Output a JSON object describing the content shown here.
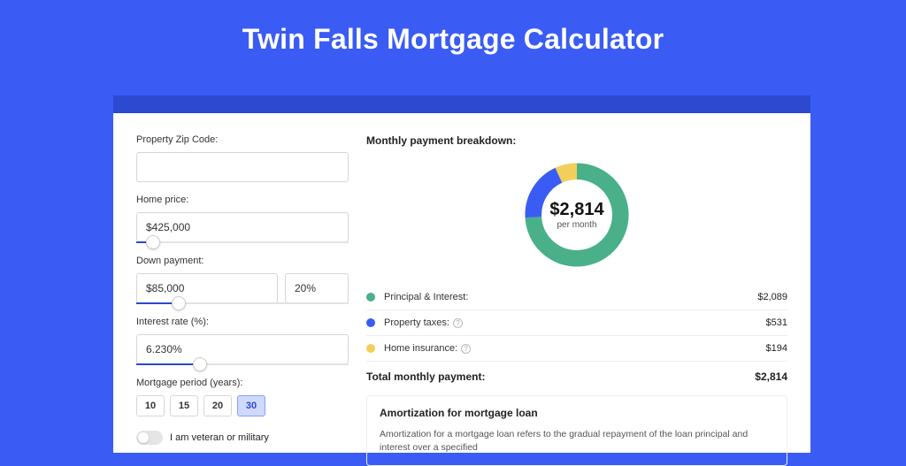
{
  "header": {
    "title": "Twin Falls Mortgage Calculator"
  },
  "form": {
    "zip": {
      "label": "Property Zip Code:",
      "value": ""
    },
    "home_price": {
      "label": "Home price:",
      "value": "$425,000",
      "slider_pct": 8
    },
    "down_payment": {
      "label": "Down payment:",
      "value": "$85,000",
      "pct": "20%",
      "slider_pct": 20
    },
    "interest": {
      "label": "Interest rate (%):",
      "value": "6.230%",
      "slider_pct": 30
    },
    "period": {
      "label": "Mortgage period (years):",
      "options": [
        "10",
        "15",
        "20",
        "30"
      ],
      "selected": "30"
    },
    "veteran": {
      "label": "I am veteran or military",
      "on": false
    }
  },
  "breakdown": {
    "title": "Monthly payment breakdown:",
    "total_value": "$2,814",
    "total_sub": "per month",
    "items": [
      {
        "label": "Principal & Interest:",
        "value": "$2,089",
        "color": "#49B08A",
        "has_info": false,
        "pct": 74
      },
      {
        "label": "Property taxes:",
        "value": "$531",
        "color": "#3A5CF5",
        "has_info": true,
        "pct": 19
      },
      {
        "label": "Home insurance:",
        "value": "$194",
        "color": "#F2CE5B",
        "has_info": true,
        "pct": 7
      }
    ],
    "total_label": "Total monthly payment:",
    "total_amount": "$2,814"
  },
  "amort": {
    "title": "Amortization for mortgage loan",
    "text": "Amortization for a mortgage loan refers to the gradual repayment of the loan principal and interest over a specified"
  },
  "chart_data": {
    "type": "pie",
    "title": "Monthly payment breakdown",
    "series": [
      {
        "name": "Principal & Interest",
        "value": 2089,
        "color": "#49B08A"
      },
      {
        "name": "Property taxes",
        "value": 531,
        "color": "#3A5CF5"
      },
      {
        "name": "Home insurance",
        "value": 194,
        "color": "#F2CE5B"
      }
    ],
    "total": 2814,
    "unit": "USD per month"
  }
}
